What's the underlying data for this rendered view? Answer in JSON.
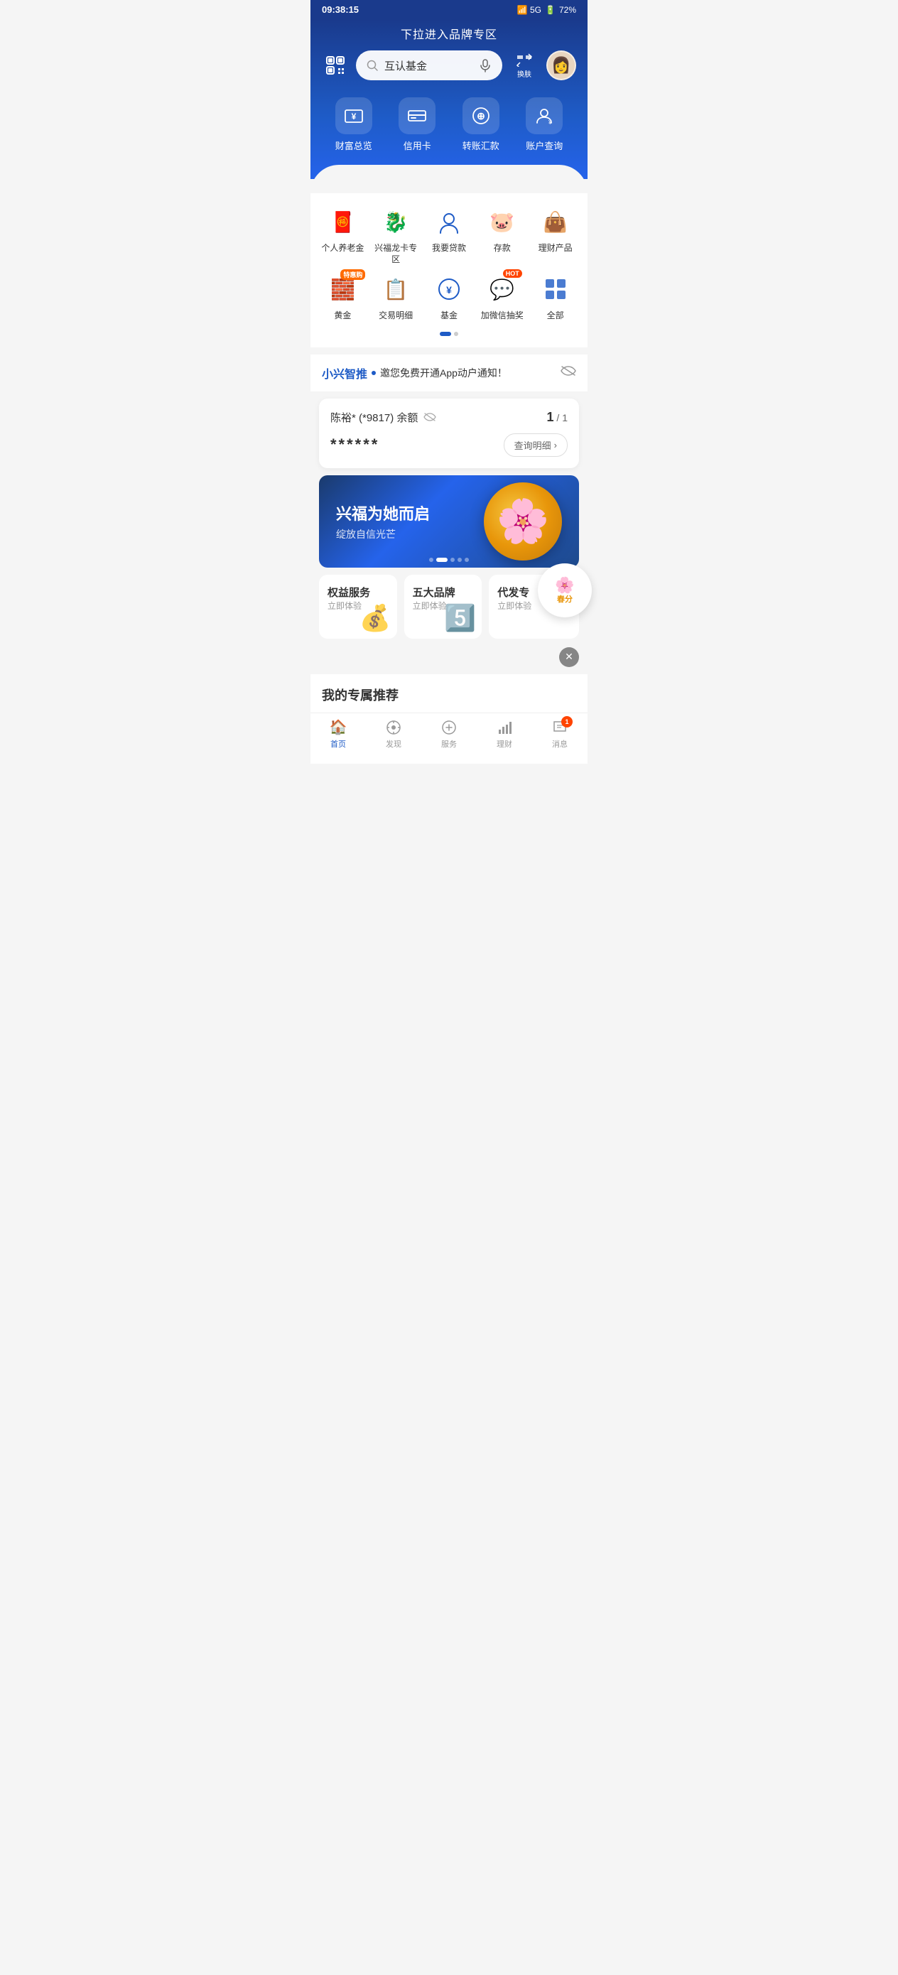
{
  "statusBar": {
    "time": "09:38:15",
    "battery": "72%"
  },
  "pullHint": "下拉进入品牌专区",
  "search": {
    "placeholder": "互认基金"
  },
  "skinBtn": {
    "label": "换\n肤",
    "icon": "🔄"
  },
  "mainNav": [
    {
      "id": "wealth",
      "icon": "👛",
      "label": "财富总览"
    },
    {
      "id": "credit",
      "icon": "💳",
      "label": "信用卡"
    },
    {
      "id": "transfer",
      "icon": "⊕",
      "label": "转账汇款"
    },
    {
      "id": "account",
      "icon": "👤",
      "label": "账户查询"
    }
  ],
  "secondaryGrid": {
    "row1": [
      {
        "id": "pension",
        "icon": "🧧",
        "label": "个人养老金",
        "badge": ""
      },
      {
        "id": "xingfu",
        "icon": "🐉",
        "label": "兴福龙卡专区",
        "badge": ""
      },
      {
        "id": "loan",
        "icon": "👤",
        "label": "我要贷款",
        "badge": ""
      },
      {
        "id": "deposit",
        "icon": "🐷",
        "label": "存款",
        "badge": ""
      },
      {
        "id": "wealth-product",
        "icon": "👜",
        "label": "理财产品",
        "badge": ""
      }
    ],
    "row2": [
      {
        "id": "gold",
        "icon": "🧱",
        "label": "黄金",
        "badge": "特惠购"
      },
      {
        "id": "transaction",
        "icon": "📋",
        "label": "交易明细",
        "badge": ""
      },
      {
        "id": "fund",
        "icon": "¥",
        "label": "基金",
        "badge": ""
      },
      {
        "id": "wechat",
        "icon": "💬",
        "label": "加微信抽奖",
        "badge": "HOT"
      },
      {
        "id": "all",
        "icon": "⊞",
        "label": "全部",
        "badge": ""
      }
    ],
    "dots": [
      {
        "active": true
      },
      {
        "active": false
      }
    ]
  },
  "smartPush": {
    "brand": "小兴智推",
    "dotColor": "#1e5bc6",
    "text": "邀您免费开通App动户通知！"
  },
  "accountCard": {
    "name": "陈裕* (*9817) 余额",
    "balance": "******",
    "page": "1",
    "total": "1",
    "queryLabel": "查询明细"
  },
  "promoBanner": {
    "title": "兴福为她而启",
    "subtitle": "绽放自信光芒",
    "dots": [
      {
        "active": false
      },
      {
        "active": true
      },
      {
        "active": false
      },
      {
        "active": false
      },
      {
        "active": false
      }
    ]
  },
  "serviceCards": [
    {
      "id": "benefits",
      "title": "权益服务",
      "subtitle": "立即体验",
      "icon": "💰"
    },
    {
      "id": "brands",
      "title": "五大品牌",
      "subtitle": "立即体验",
      "icon": "5️⃣"
    },
    {
      "id": "payroll",
      "title": "代发专",
      "subtitle": "立即体验",
      "icon": "🏦"
    }
  ],
  "floatBtn": {
    "topText": "春",
    "bottomText": "分"
  },
  "myRecommendations": {
    "title": "我的专属推荐"
  },
  "bottomNav": [
    {
      "id": "home",
      "icon": "🏠",
      "label": "首页",
      "active": true,
      "badge": ""
    },
    {
      "id": "discover",
      "icon": "🔍",
      "label": "发现",
      "active": false,
      "badge": ""
    },
    {
      "id": "services",
      "icon": "⊕",
      "label": "服务",
      "active": false,
      "badge": ""
    },
    {
      "id": "finance",
      "icon": "📊",
      "label": "理财",
      "active": false,
      "badge": ""
    },
    {
      "id": "message",
      "icon": "💬",
      "label": "消息",
      "active": false,
      "badge": "1"
    }
  ]
}
